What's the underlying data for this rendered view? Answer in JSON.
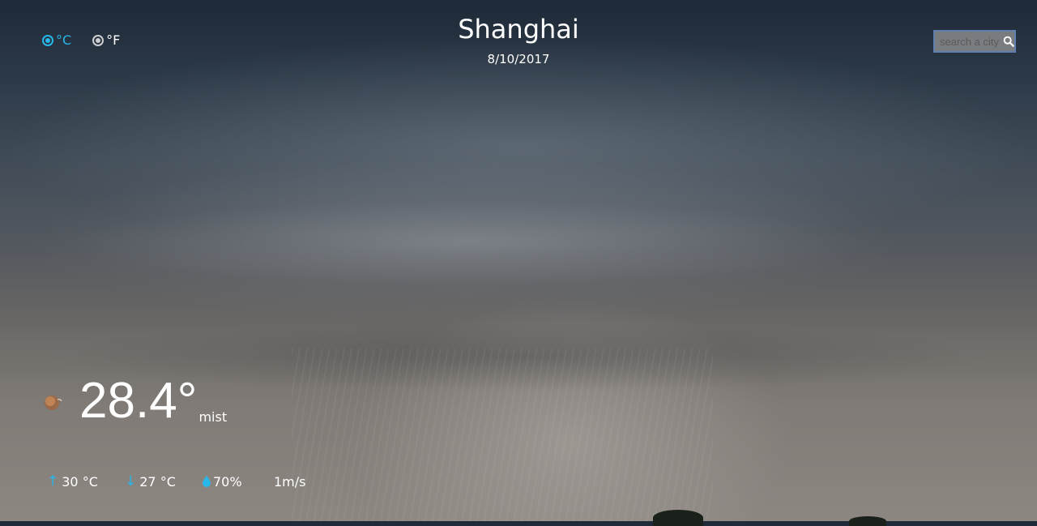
{
  "units": {
    "celsius_label": "°C",
    "fahrenheit_label": "°F",
    "selected": "celsius"
  },
  "header": {
    "city": "Shanghai",
    "date": "8/10/2017"
  },
  "search": {
    "placeholder": "search a city",
    "value": "",
    "icon": "search-icon"
  },
  "current": {
    "icon": "mist-icon",
    "temperature": "28.4°",
    "description": "mist"
  },
  "stats": {
    "high": "30 °C",
    "low": "27 °C",
    "humidity": "70%",
    "wind": "1m/s"
  },
  "colors": {
    "accent": "#29b6e8",
    "search_border": "#5f7fae"
  }
}
